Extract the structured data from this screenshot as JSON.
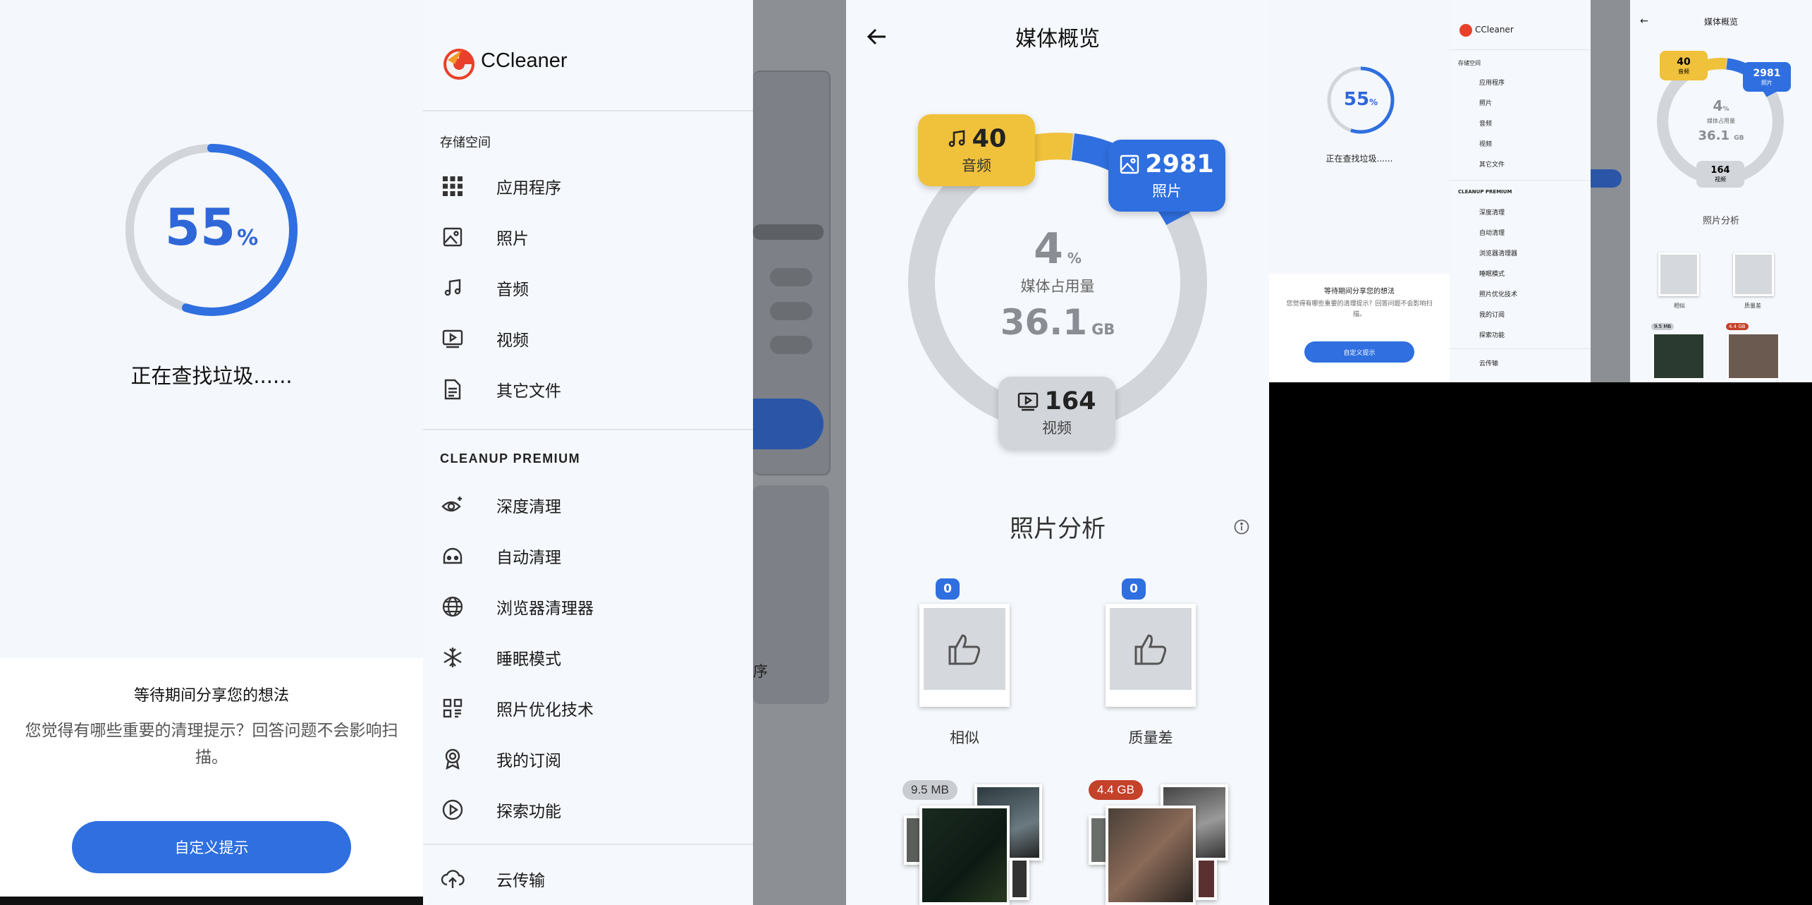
{
  "scan": {
    "percent": "55",
    "percent_symbol": "%",
    "progress_fraction": 0.55,
    "status": "正在查找垃圾......",
    "sheet_title": "等待期间分享您的想法",
    "sheet_body": "您觉得有哪些重要的清理提示？回答问题不会影响扫描。",
    "cta_label": "自定义提示"
  },
  "drawer": {
    "brand": "CCleaner",
    "storage_header": "存储空间",
    "storage_items": [
      {
        "label": "应用程序",
        "icon": "apps-grid-icon"
      },
      {
        "label": "照片",
        "icon": "image-icon"
      },
      {
        "label": "音频",
        "icon": "music-note-icon"
      },
      {
        "label": "视频",
        "icon": "video-icon"
      },
      {
        "label": "其它文件",
        "icon": "document-icon"
      }
    ],
    "premium_header": "CLEANUP PREMIUM",
    "premium_items": [
      {
        "label": "深度清理",
        "icon": "eye-sparkle-icon"
      },
      {
        "label": "自动清理",
        "icon": "robot-icon"
      },
      {
        "label": "浏览器清理器",
        "icon": "globe-icon"
      },
      {
        "label": "睡眠模式",
        "icon": "snowflake-icon"
      },
      {
        "label": "照片优化技术",
        "icon": "photo-optimize-icon"
      },
      {
        "label": "我的订阅",
        "icon": "badge-icon"
      },
      {
        "label": "探索功能",
        "icon": "play-circle-icon"
      }
    ],
    "cloud_label": "云传输",
    "behind_text": "序"
  },
  "media": {
    "title": "媒体概览",
    "usage_percent": "4",
    "usage_percent_symbol": "%",
    "usage_label": "媒体占用量",
    "usage_size": "36.1",
    "usage_unit": "GB",
    "audio": {
      "count": "40",
      "label": "音频",
      "color": "#f0c13a"
    },
    "photos": {
      "count": "2981",
      "label": "照片",
      "color": "#2f6fe0"
    },
    "videos": {
      "count": "164",
      "label": "视频",
      "color": "#d2d5da"
    },
    "photo_analysis_title": "照片分析",
    "similar": {
      "count": "0",
      "label": "相似"
    },
    "low_quality": {
      "count": "0",
      "label": "质量差"
    },
    "chip_left": "9.5 MB",
    "chip_right": "4.4 GB"
  },
  "colors": {
    "accent": "#2f6fe0",
    "audio_yellow": "#f0c13a",
    "ring_grey": "#d2d5da",
    "danger": "#c4412a"
  }
}
